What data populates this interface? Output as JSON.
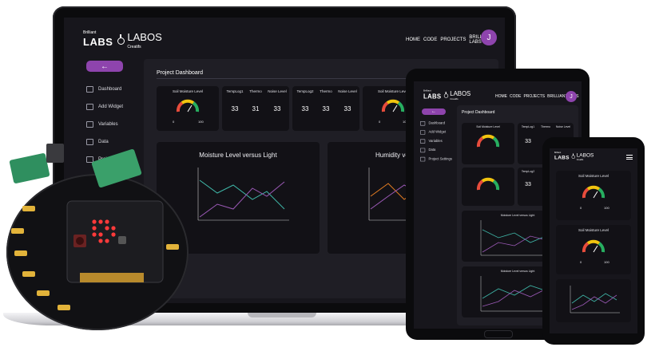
{
  "app": {
    "logo_small": "Brilliant",
    "logo_big": "LABS",
    "logo_alt": "LABOS",
    "logo_sub": "Creatifs",
    "nav": [
      "HOME",
      "CODE",
      "PROJECTS",
      "BRILLIANT LABS"
    ],
    "avatar_initial": "J",
    "back_label": "←",
    "page_title": "Project Dashboard",
    "accent": "#8e44ad",
    "sidebar": [
      {
        "label": "Dashboard",
        "icon": "dashboard-icon"
      },
      {
        "label": "Add Widget",
        "icon": "plus-icon"
      },
      {
        "label": "Variables",
        "icon": "database-icon"
      },
      {
        "label": "Data",
        "icon": "data-icon"
      },
      {
        "label": "Project S",
        "icon": "settings-icon"
      }
    ]
  },
  "widgets": {
    "gauge": {
      "title": "Soil Moisture Level",
      "min": "0",
      "max": "100"
    },
    "group1": {
      "labels": [
        "TempLog1",
        "Thermo",
        "Noise Level"
      ],
      "values": [
        "33",
        "31",
        "33"
      ]
    },
    "group2": {
      "labels": [
        "TempLog2",
        "Thermo",
        "Noise Level"
      ],
      "values": [
        "33",
        "33",
        "33"
      ]
    }
  },
  "charts": {
    "moisture_title": "Moisture Level versus Light",
    "humidity_title": "Humidity versu"
  },
  "tablet": {
    "sidebar": [
      "Dashboard",
      "Add Widget",
      "Variables",
      "Data",
      "Project Settings"
    ],
    "chart_title": "Moisture Level versus Light",
    "values": [
      "33",
      "33"
    ]
  },
  "phone": {
    "gauge_title": "Soil Moisture Level"
  }
}
